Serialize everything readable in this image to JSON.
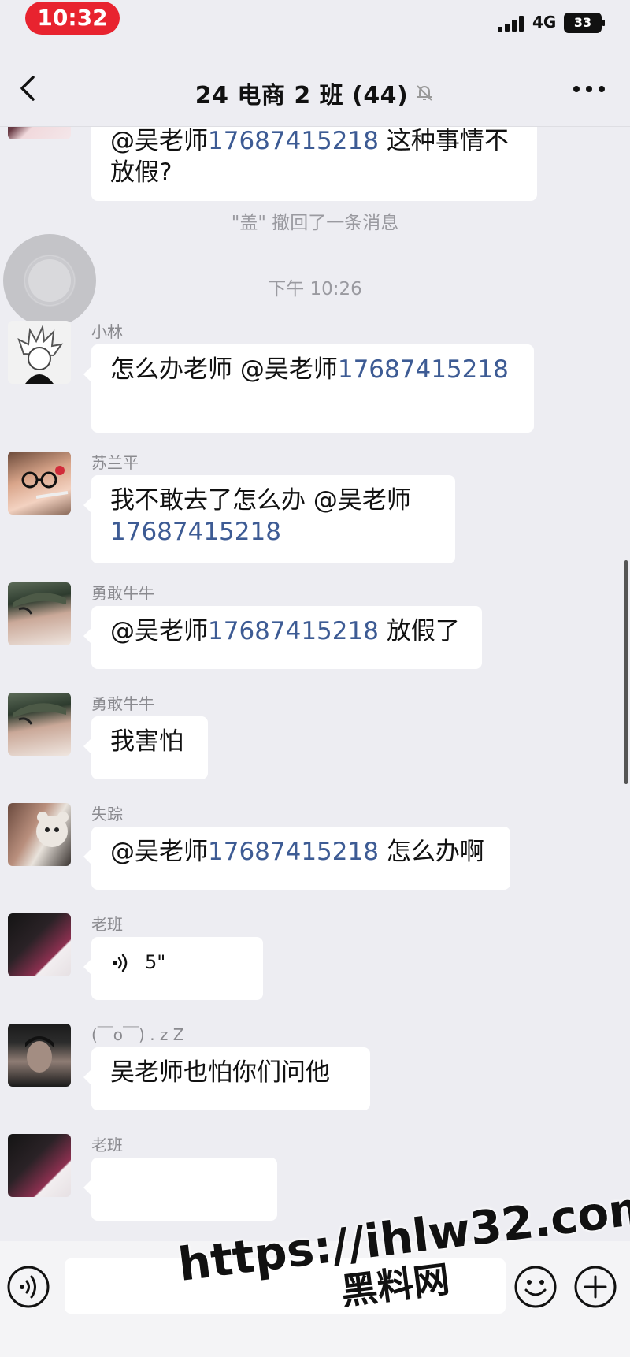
{
  "status_bar": {
    "time": "10:32",
    "network": "4G",
    "battery": "33"
  },
  "nav": {
    "title": "24 电商 2 班 (44)"
  },
  "messages": [
    {
      "type": "bubble_continuation",
      "mention": "@吴老师",
      "phone": "17687415218",
      "text_after": " 这种事情不",
      "line2": "放假?"
    },
    {
      "type": "system",
      "text": "\"盖\" 撤回了一条消息"
    },
    {
      "type": "time",
      "text": "下午 10:26"
    },
    {
      "sender": "小林",
      "avatar_icon": "spiky-hair-anime-avatar",
      "mention": "怎么办老师 @吴老师",
      "phone": "17687415218"
    },
    {
      "sender": "苏兰平",
      "avatar_icon": "girl-toothbrush-avatar",
      "text": "我不敢去了怎么办 @吴老师",
      "phone": "17687415218"
    },
    {
      "sender": "勇敢牛牛",
      "avatar_icon": "cap-boy-avatar",
      "mention": "@吴老师",
      "phone": "17687415218",
      "text_after": " 放假了"
    },
    {
      "sender": "勇敢牛牛",
      "avatar_icon": "cap-boy-avatar",
      "text": "我害怕"
    },
    {
      "sender": "失踪",
      "avatar_icon": "girl-teddy-bear-avatar",
      "mention": "@吴老师",
      "phone": "17687415218",
      "text_after": " 怎么办啊"
    },
    {
      "sender": "老班",
      "avatar_icon": "dark-photo-avatar",
      "voice_duration": "5\""
    },
    {
      "sender": "(￣o￣) . z Z",
      "avatar_icon": "man-portrait-avatar",
      "text": "吴老师也怕你们问他"
    },
    {
      "sender": "老班",
      "avatar_icon": "dark-photo-avatar"
    }
  ],
  "input": {
    "placeholder": ""
  },
  "watermark": {
    "url": "https://ihlw32.com",
    "name": "黑料网"
  },
  "colors": {
    "background": "#ededf2",
    "bubble": "#ffffff",
    "phone_link": "#3d5b94",
    "time_pill": "#e8232f"
  }
}
